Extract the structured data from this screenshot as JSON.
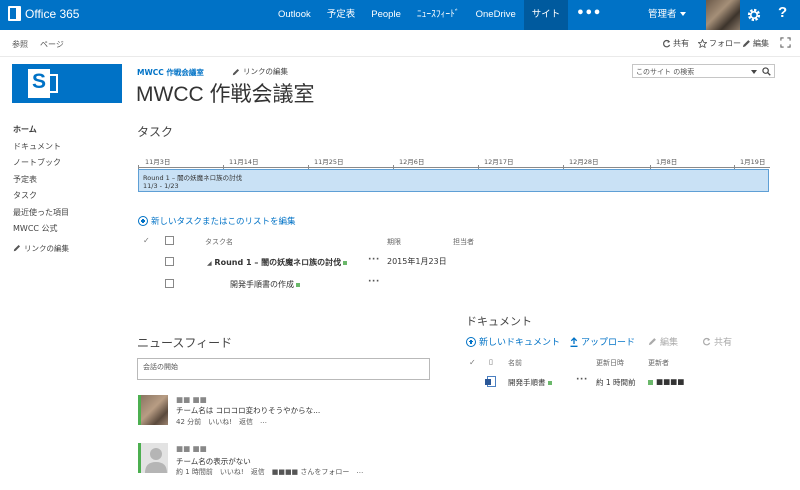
{
  "suitebar": {
    "app_name": "Office 365",
    "nav": [
      {
        "label": "Outlook",
        "active": false
      },
      {
        "label": "予定表",
        "active": false
      },
      {
        "label": "People",
        "active": false
      },
      {
        "label": "ﾆｭｰｽﾌｨｰﾄﾞ",
        "active": false
      },
      {
        "label": "OneDrive",
        "active": false
      },
      {
        "label": "サイト",
        "active": true
      }
    ],
    "more": "•••",
    "user": "管理者",
    "help": "?"
  },
  "ribbon": {
    "tabs": [
      "参照",
      "ページ"
    ],
    "share": "共有",
    "follow": "フォロー",
    "edit": "編集"
  },
  "site": {
    "breadcrumb": "MWCC 作戦会議室",
    "edit_links": "リンクの編集",
    "title": "MWCC 作戦会議室",
    "search_placeholder": "このサイト の検索"
  },
  "leftnav": {
    "items": [
      "ホーム",
      "ドキュメント",
      "ノートブック",
      "予定表",
      "タスク",
      "最近使った項目",
      "MWCC 公式"
    ],
    "selected_index": 0,
    "edit_links": "リンクの編集"
  },
  "tasks": {
    "heading": "タスク",
    "timeline_dates": [
      "11月3日",
      "11月14日",
      "11月25日",
      "12月6日",
      "12月17日",
      "12月28日",
      "1月8日",
      "1月19日"
    ],
    "timeline_bar": {
      "title": "Round 1 – 闇の妖魔ネロ族の討伐",
      "range": "11/3 - 1/23"
    },
    "new_task_prefix": "新しいタスクまたはこのリストを",
    "new_task_link": "編集",
    "columns": {
      "name": "タスク名",
      "due": "期限",
      "assignee": "担当者"
    },
    "rows": [
      {
        "name": "Round 1 – 闇の妖魔ネロ族の討伐",
        "due": "2015年1月23日"
      },
      {
        "name": "開発手順書の作成",
        "due": ""
      }
    ]
  },
  "newsfeed": {
    "heading": "ニュースフィード",
    "placeholder": "会話の開始",
    "posts": [
      {
        "author": "■■ ■■",
        "text": "チーム名は コロコロ変わりそうやからな...",
        "time": "42 分前",
        "like": "いいね!",
        "reply": "返信",
        "more": "…"
      },
      {
        "author": "■■ ■■",
        "text": "チーム名の表示がない",
        "time": "約 1 時間前",
        "like": "いいね!",
        "reply": "返信",
        "follow": "■■■■ さんをフォロー",
        "more": "…"
      }
    ]
  },
  "documents": {
    "heading": "ドキュメント",
    "new_doc": "新しいドキュメント",
    "upload": "アップロード",
    "edit": "編集",
    "share": "共有",
    "columns": {
      "name": "名前",
      "modified": "更新日時",
      "modified_by": "更新者"
    },
    "rows": [
      {
        "name": "開発手順書",
        "modified": "約 1 時間前",
        "modified_by": "■■■■"
      }
    ]
  },
  "colors": {
    "suitebar": "#0072c6",
    "suitebar_active": "#005a9e",
    "accent": "#0072c6",
    "timeline_bar": "#c9e1f5",
    "presence_green": "#6bb86b"
  }
}
